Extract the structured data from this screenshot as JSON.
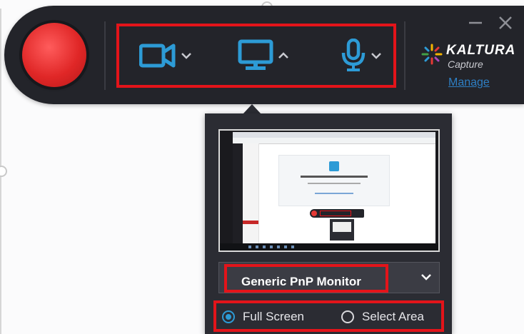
{
  "toolbar": {
    "record_button_color": "#e02727",
    "accent_color": "#2d9bd6",
    "highlight_color": "#e3141a",
    "sources": [
      {
        "name": "camera",
        "icon": "camera-icon",
        "menu_state": "collapsed"
      },
      {
        "name": "screen",
        "icon": "monitor-icon",
        "menu_state": "expanded"
      },
      {
        "name": "audio",
        "icon": "microphone-icon",
        "menu_state": "collapsed"
      }
    ],
    "brand_name": "KALTURA",
    "brand_sub": "Capture",
    "manage_label": "Manage",
    "window_controls": [
      "minimize-icon",
      "close-icon"
    ]
  },
  "screen_panel": {
    "monitor_selected": "Generic PnP Monitor",
    "modes": [
      {
        "label": "Full Screen",
        "selected": true
      },
      {
        "label": "Select Area",
        "selected": false
      }
    ]
  }
}
